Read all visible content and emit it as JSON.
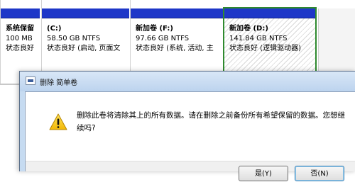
{
  "partitions": [
    {
      "name": "系统保留",
      "line1": "100 MB",
      "line2": "状态良好"
    },
    {
      "name": "(C:)",
      "line1": "58.50 GB NTFS",
      "line2": "状态良好 (启动, 页面文"
    },
    {
      "name": "新加卷  (F:)",
      "line1": "97.66 GB NTFS",
      "line2": "状态良好 (系统, 活动, 主"
    },
    {
      "name": "新加卷  (D:)",
      "line1": "141.84 GB NTFS",
      "line2": "状态良好 (逻辑驱动器)"
    }
  ],
  "dialog": {
    "title": "删除 简单卷",
    "message": "删除此卷将清除其上的所有数据。请在删除之前备份所有希望保留的数据。您想继续吗?",
    "yes_label": "是(Y)",
    "no_label": "否(N)"
  },
  "colors": {
    "partition_bar": "#1e37c8",
    "selected_border": "#2f8a2f",
    "dialog_frame": "#c6dbf1"
  }
}
